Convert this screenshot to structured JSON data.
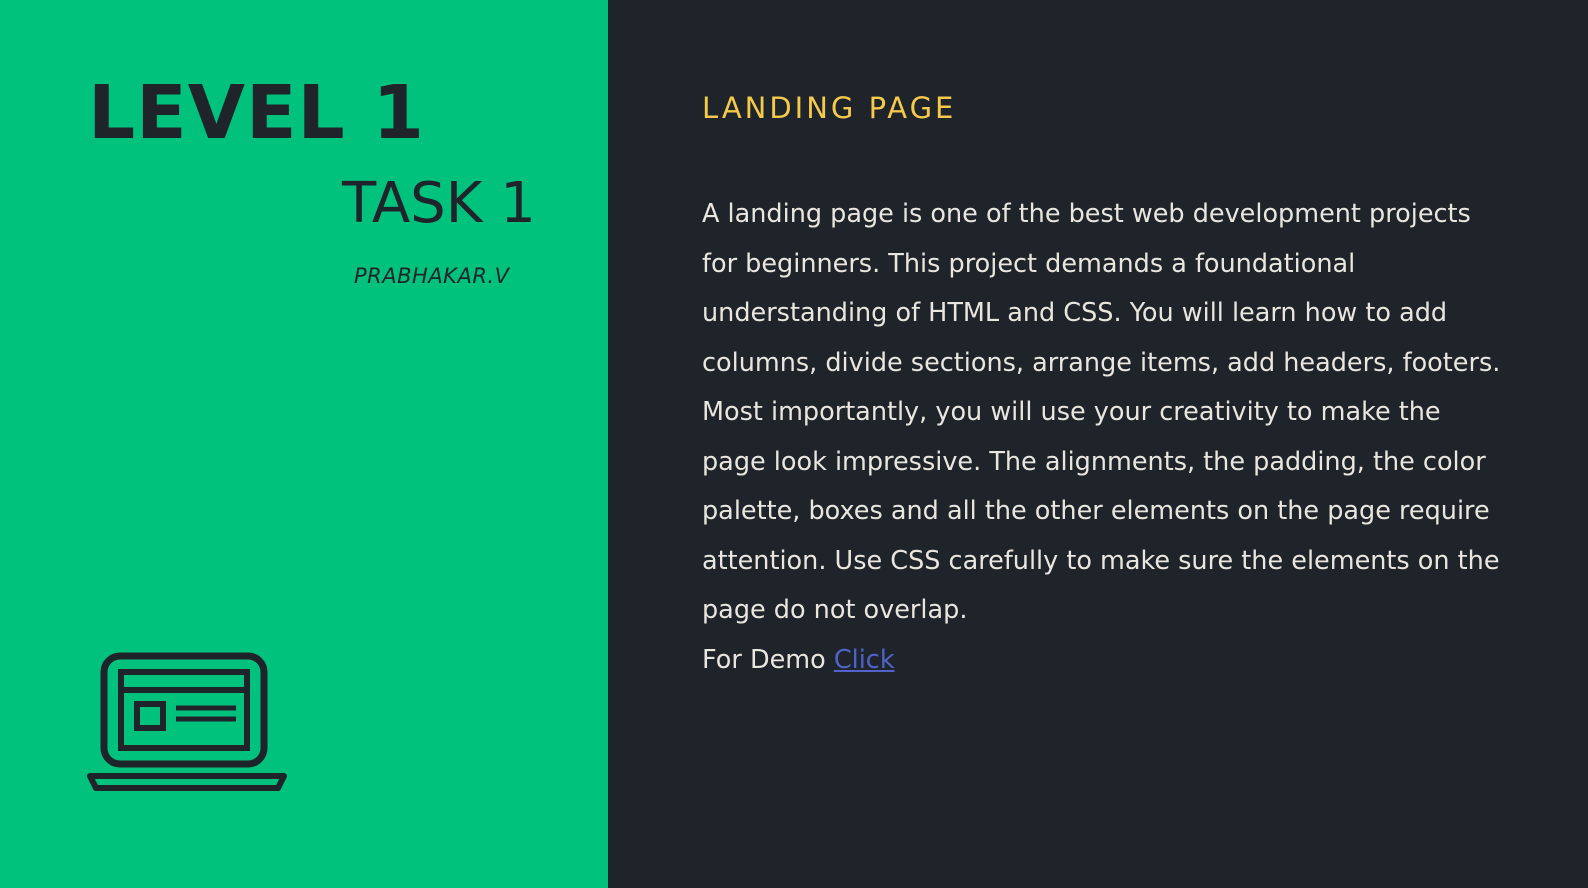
{
  "left": {
    "level": "LEVEL 1",
    "task": "TASK 1",
    "author": "PRABHAKAR.V",
    "icon": "laptop-icon"
  },
  "right": {
    "heading": "LANDING PAGE",
    "description": "A landing page is one of the best web development projects for beginners. This project demands a foundational understanding of HTML and CSS. You will learn how to add columns, divide sections, arrange items, add headers, footers. Most importantly, you will use your creativity to make the page look impressive. The alignments, the padding, the color palette, boxes and all the other elements on the page require attention. Use CSS carefully to make sure the elements on the page do not overlap.",
    "demo_prefix": "For Demo ",
    "demo_link": "Click "
  },
  "colors": {
    "left_background": "#00c27c",
    "right_background": "#1f242a",
    "heading_accent": "#f5c94a",
    "body_text": "#e9e6df",
    "link": "#4f63c9"
  }
}
